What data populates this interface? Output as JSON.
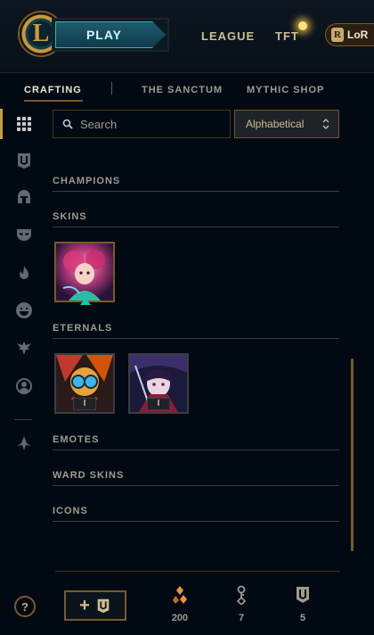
{
  "top_nav": {
    "logo_letter": "L",
    "play_label": "PLAY",
    "links": [
      "LEAGUE",
      "TFT"
    ],
    "lor_label": "LoR"
  },
  "sub_nav": {
    "tabs": [
      "CRAFTING",
      "THE SANCTUM",
      "MYTHIC SHOP"
    ],
    "active_tab": "CRAFTING"
  },
  "sidebar": {
    "icons": [
      "grid-icon",
      "chest-icon",
      "helmet-icon",
      "mask-icon",
      "fire-icon",
      "emote-icon",
      "ward-icon",
      "profile-icon",
      "arrow-up-icon"
    ],
    "active_icon": "grid-icon"
  },
  "search": {
    "placeholder": "Search",
    "value": ""
  },
  "sort": {
    "selected": "Alphabetical"
  },
  "sections": {
    "champions": "CHAMPIONS",
    "skins": "SKINS",
    "eternals": "ETERNALS",
    "emotes": "EMOTES",
    "ward_skins": "WARD SKINS",
    "icons": "ICONS"
  },
  "eternals": [
    {
      "badge": "I"
    },
    {
      "badge": "I"
    }
  ],
  "footer": {
    "help_label": "?",
    "add_label": "+",
    "currencies": [
      {
        "icon": "orange-essence-icon",
        "value": "200"
      },
      {
        "icon": "key-icon",
        "value": "7"
      },
      {
        "icon": "chest-icon",
        "value": "5"
      }
    ]
  },
  "colors": {
    "gold": "#c89b3c",
    "teal": "#0ac8b9",
    "background": "#010a13",
    "essence_orange": "#f0923a"
  }
}
